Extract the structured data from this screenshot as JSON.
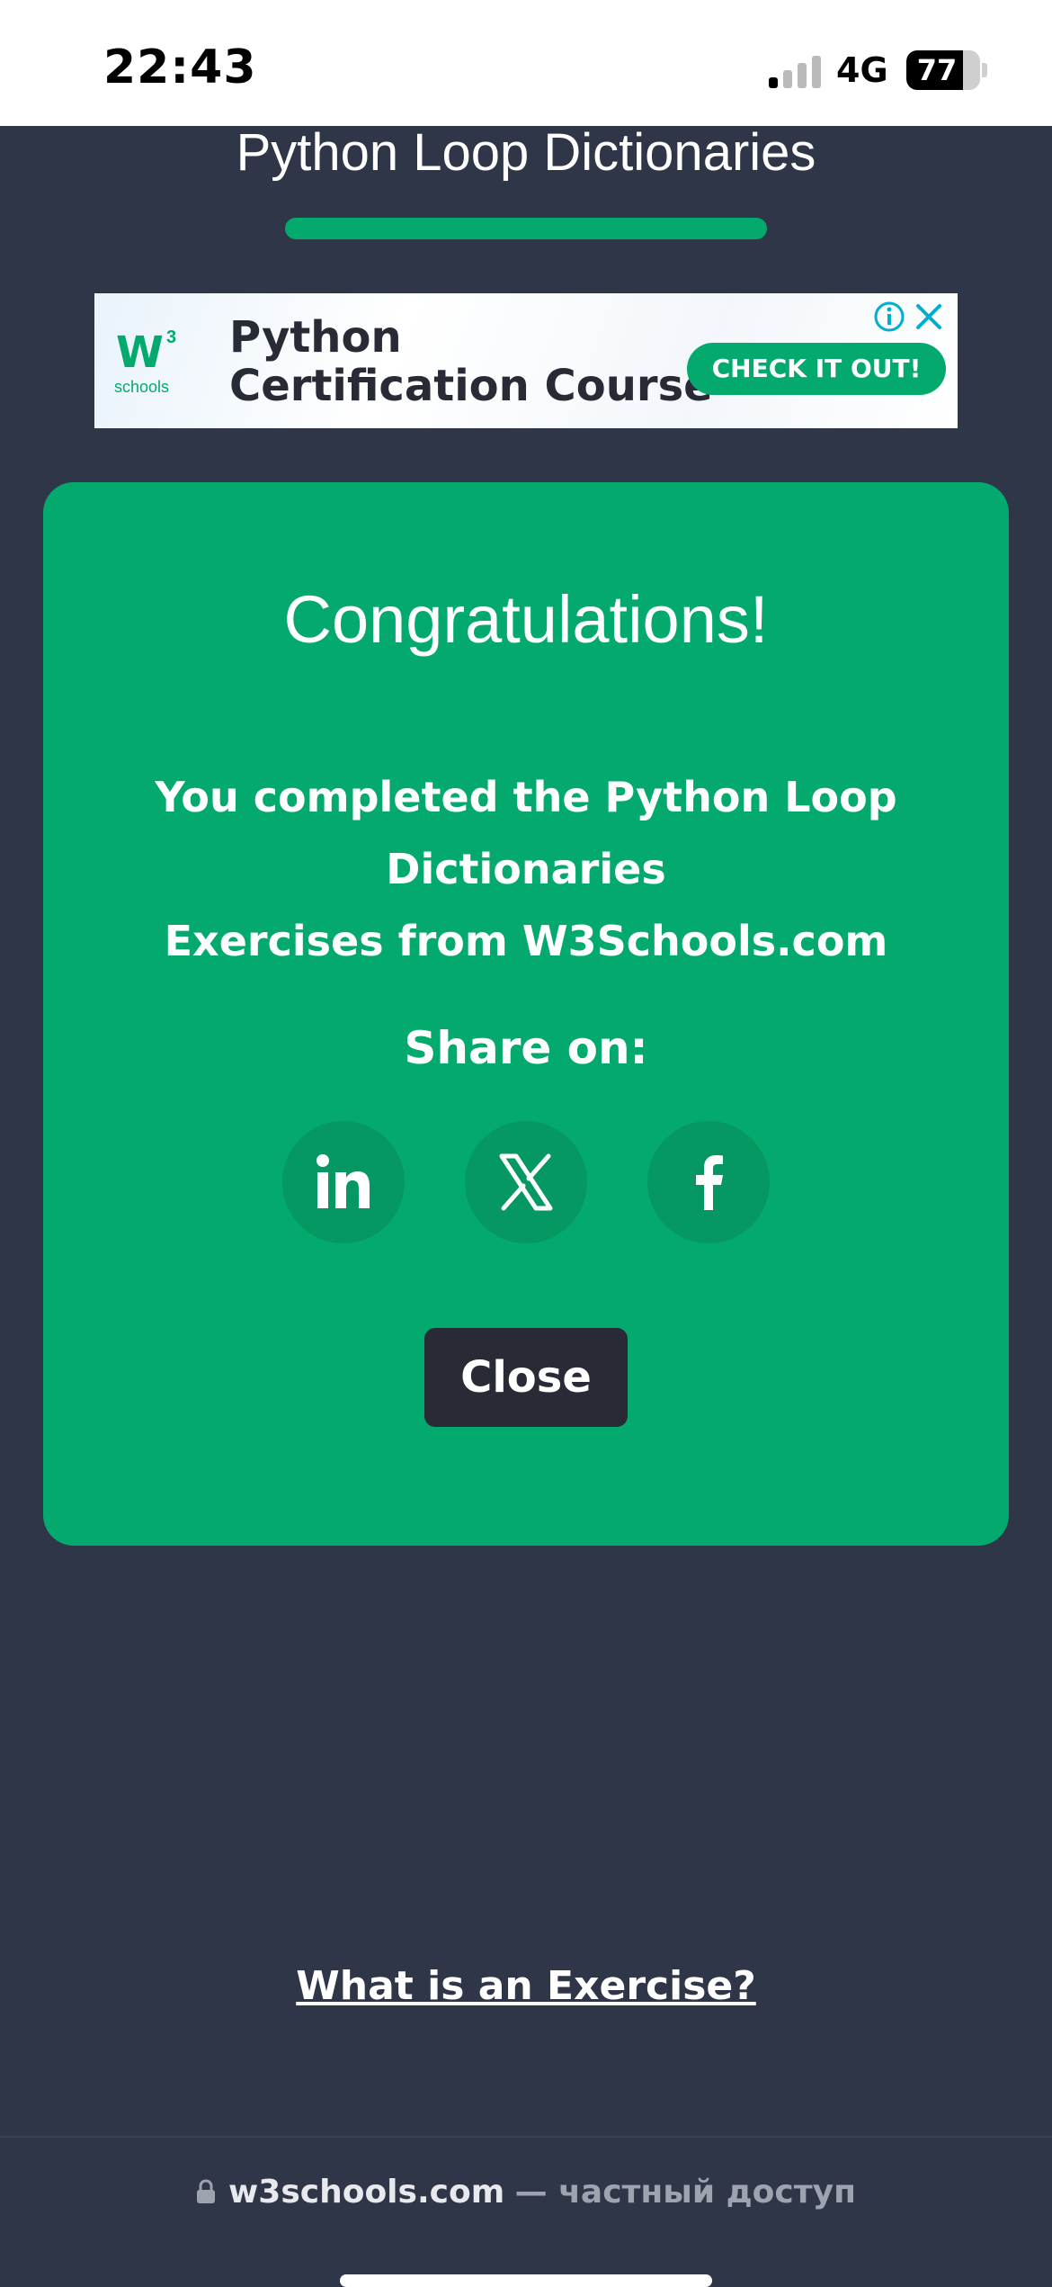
{
  "status_bar": {
    "time": "22:43",
    "network": "4G",
    "battery": "77",
    "battery_level": 0.77,
    "signal_bars_active": 1,
    "signal_bars_total": 4
  },
  "page": {
    "title": "Python Loop Dictionaries",
    "progress": 1.0
  },
  "ad": {
    "logo_text": "W",
    "logo_sup": "3",
    "logo_sub": "schools",
    "headline_line1": "Python",
    "headline_line2": "Certification Course",
    "cta": "CHECK IT OUT!",
    "info_icon": "info-icon",
    "close_icon": "close-icon"
  },
  "modal": {
    "heading": "Congratulations!",
    "message_line1": "You completed the Python Loop Dictionaries",
    "message_line2": "Exercises from W3Schools.com",
    "share_label": "Share on:",
    "share_icons": [
      "linkedin-icon",
      "x-icon",
      "facebook-icon"
    ],
    "close_label": "Close"
  },
  "footer": {
    "exercise_link": "What is an Exercise?"
  },
  "browser": {
    "domain": "w3schools.com",
    "suffix": "— частный доступ"
  },
  "colors": {
    "background": "#2f3648",
    "accent": "#04aa6d",
    "button_dark": "#282a35"
  }
}
